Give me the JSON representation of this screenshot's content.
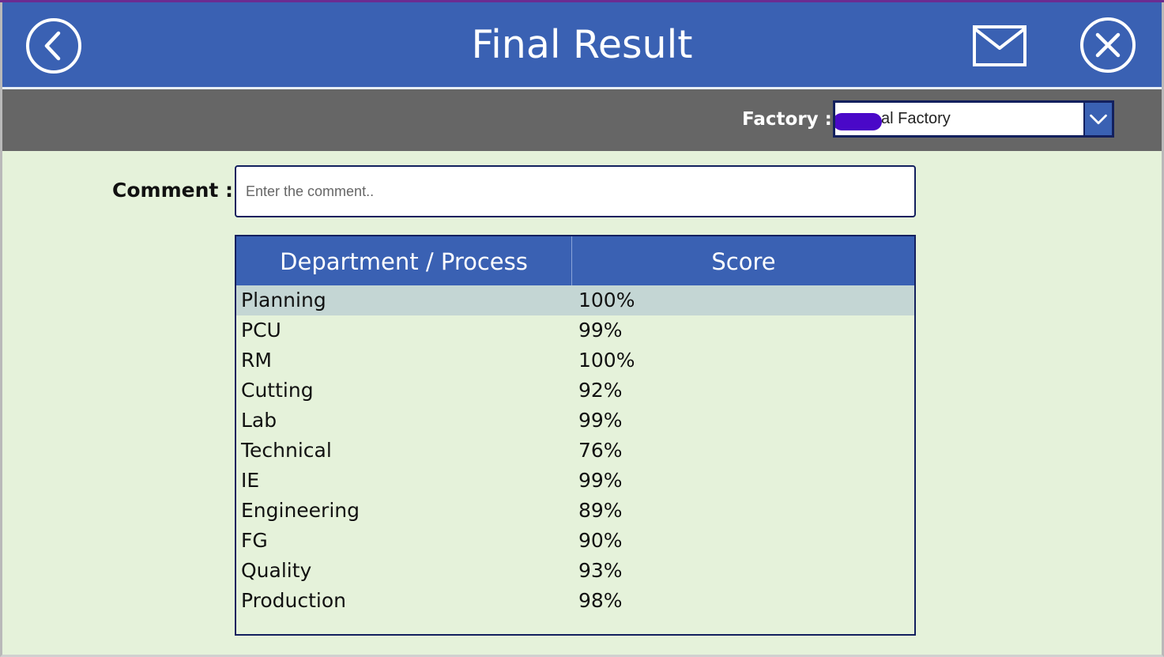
{
  "header": {
    "title": "Final Result",
    "back_icon": "chevron-left-circle-icon",
    "mail_icon": "envelope-icon",
    "close_icon": "close-circle-icon"
  },
  "filter": {
    "factory_label": "Factory :",
    "factory_value": "al Factory"
  },
  "comment": {
    "label": "Comment :",
    "placeholder": "Enter the comment..",
    "value": ""
  },
  "table": {
    "columns": [
      "Department / Process",
      "Score"
    ],
    "selected_row": 0,
    "rows": [
      {
        "department": "Planning",
        "score": "100%"
      },
      {
        "department": "PCU",
        "score": "99%"
      },
      {
        "department": "RM",
        "score": "100%"
      },
      {
        "department": "Cutting",
        "score": "92%"
      },
      {
        "department": "Lab",
        "score": "99%"
      },
      {
        "department": "Technical",
        "score": "76%"
      },
      {
        "department": "IE",
        "score": "99%"
      },
      {
        "department": "Engineering",
        "score": "89%"
      },
      {
        "department": "FG",
        "score": "90%"
      },
      {
        "department": "Quality",
        "score": "93%"
      },
      {
        "department": "Production",
        "score": "98%"
      }
    ]
  },
  "colors": {
    "header_blue": "#3a61b3",
    "filter_gray": "#666666",
    "page_bg": "#e5f2da",
    "selected_row": "#c4d6d4",
    "border_navy": "#13205e"
  }
}
